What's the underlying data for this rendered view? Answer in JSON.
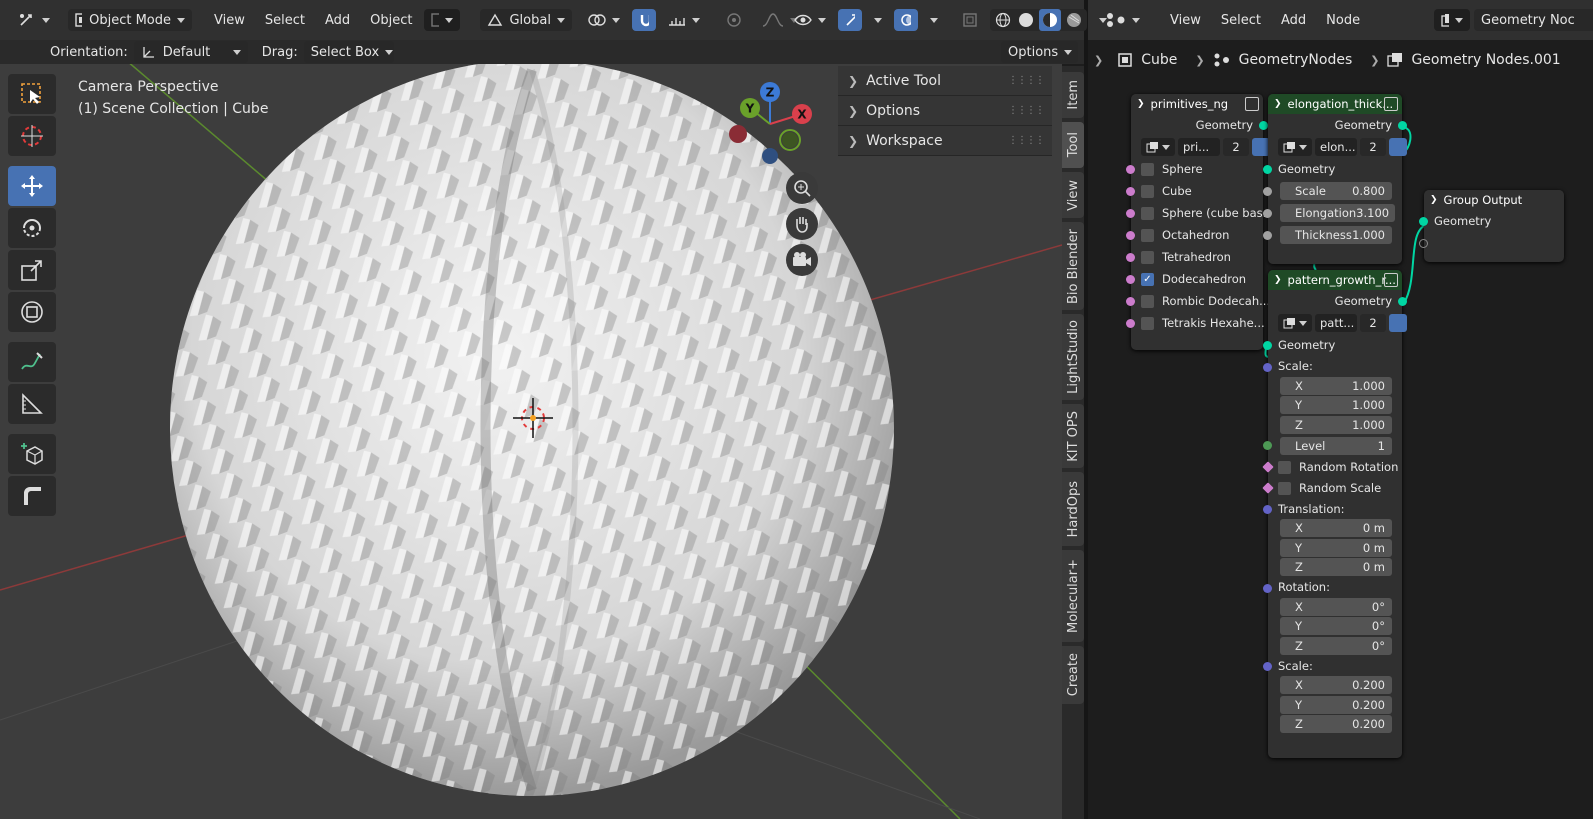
{
  "viewport_header": {
    "mode": "Object Mode",
    "menus": [
      "View",
      "Select",
      "Add",
      "Object"
    ],
    "transform_orientation": "Global"
  },
  "tool_header": {
    "orientation_label": "Orientation:",
    "orientation_value": "Default",
    "drag_label": "Drag:",
    "drag_value": "Select Box",
    "options_label": "Options"
  },
  "viewport_overlay": {
    "line1": "Camera Perspective",
    "line2": "(1) Scene Collection | Cube"
  },
  "gizmo_axes": {
    "z": "Z",
    "y": "Y",
    "x": "X"
  },
  "sidebar_panels": [
    "Active Tool",
    "Options",
    "Workspace"
  ],
  "sidebar_tabs": [
    "Item",
    "Tool",
    "View",
    "Bio Blender",
    "LightStudio",
    "KIT OPS",
    "HardOps",
    "Molecular+",
    "Create"
  ],
  "node_editor_header": {
    "menus": [
      "View",
      "Select",
      "Add",
      "Node"
    ],
    "tree_name": "Geometry Noc"
  },
  "breadcrumb": [
    "Cube",
    "GeometryNodes",
    "Geometry Nodes.001"
  ],
  "nodes": {
    "primitives": {
      "title": "primitives_ng",
      "output": "Geometry",
      "datablock": "pri...",
      "users": "2",
      "items": [
        {
          "label": "Sphere",
          "checked": false
        },
        {
          "label": "Cube",
          "checked": false
        },
        {
          "label": "Sphere (cube bas...",
          "checked": false
        },
        {
          "label": "Octahedron",
          "checked": false
        },
        {
          "label": "Tetrahedron",
          "checked": false
        },
        {
          "label": "Dodecahedron",
          "checked": true
        },
        {
          "label": "Rombic Dodecah...",
          "checked": false
        },
        {
          "label": "Tetrakis Hexahe...",
          "checked": false
        }
      ]
    },
    "elongation": {
      "title": "elongation_thick...",
      "output": "Geometry",
      "datablock": "elon...",
      "users": "2",
      "input": "Geometry",
      "fields": [
        {
          "label": "Scale",
          "value": "0.800"
        },
        {
          "label": "Elongation",
          "value": "3.100"
        },
        {
          "label": "Thickness",
          "value": "1.000"
        }
      ]
    },
    "pattern": {
      "title": "pattern_growth_r...",
      "output": "Geometry",
      "datablock": "patt...",
      "users": "2",
      "input": "Geometry",
      "scale_label": "Scale:",
      "scale": [
        {
          "axis": "X",
          "value": "1.000"
        },
        {
          "axis": "Y",
          "value": "1.000"
        },
        {
          "axis": "Z",
          "value": "1.000"
        }
      ],
      "level_label": "Level",
      "level_value": "1",
      "random_rotation": "Random Rotation",
      "random_scale": "Random Scale",
      "translation_label": "Translation:",
      "translation": [
        {
          "axis": "X",
          "value": "0 m"
        },
        {
          "axis": "Y",
          "value": "0 m"
        },
        {
          "axis": "Z",
          "value": "0 m"
        }
      ],
      "rotation_label": "Rotation:",
      "rotation": [
        {
          "axis": "X",
          "value": "0°"
        },
        {
          "axis": "Y",
          "value": "0°"
        },
        {
          "axis": "Z",
          "value": "0°"
        }
      ],
      "scale2_label": "Scale:",
      "scale2": [
        {
          "axis": "X",
          "value": "0.200"
        },
        {
          "axis": "Y",
          "value": "0.200"
        },
        {
          "axis": "Z",
          "value": "0.200"
        }
      ]
    },
    "group_output": {
      "title": "Group Output",
      "input": "Geometry"
    }
  },
  "colors": {
    "accent": "#4772b3",
    "node_header_group": "#1f4a26",
    "geometry_socket": "#00d6a3"
  }
}
